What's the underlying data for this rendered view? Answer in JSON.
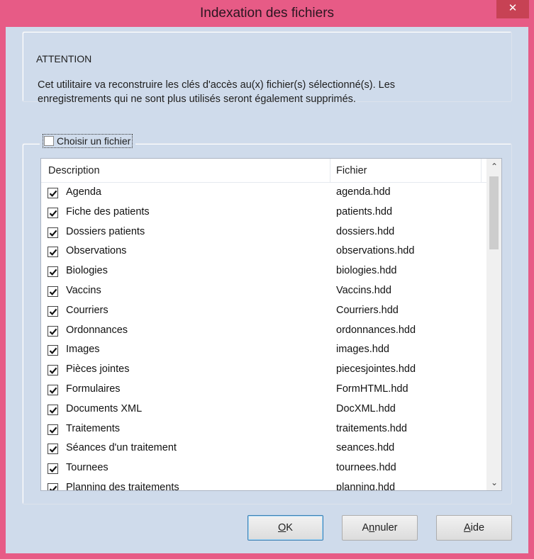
{
  "window": {
    "title": "Indexation des fichiers",
    "close_glyph": "✕"
  },
  "attention": {
    "legend": "ATTENTION",
    "line1": "Cet utilitaire va reconstruire les clés d'accès au(x) fichier(s) sélectionné(s). Les",
    "line2": "enregistrements qui ne sont plus utilisés seront également supprimés."
  },
  "choose_file": {
    "label": "Choisir un fichier",
    "checked": false
  },
  "table": {
    "columns": [
      "Description",
      "Fichier"
    ],
    "rows": [
      {
        "description": "Agenda",
        "file": "agenda.hdd",
        "checked": true
      },
      {
        "description": "Fiche des patients",
        "file": "patients.hdd",
        "checked": true
      },
      {
        "description": "Dossiers patients",
        "file": "dossiers.hdd",
        "checked": true
      },
      {
        "description": "Observations",
        "file": "observations.hdd",
        "checked": true
      },
      {
        "description": "Biologies",
        "file": "biologies.hdd",
        "checked": true
      },
      {
        "description": "Vaccins",
        "file": "Vaccins.hdd",
        "checked": true
      },
      {
        "description": "Courriers",
        "file": "Courriers.hdd",
        "checked": true
      },
      {
        "description": "Ordonnances",
        "file": "ordonnances.hdd",
        "checked": true
      },
      {
        "description": "Images",
        "file": "images.hdd",
        "checked": true
      },
      {
        "description": "Pièces jointes",
        "file": "piecesjointes.hdd",
        "checked": true
      },
      {
        "description": "Formulaires",
        "file": "FormHTML.hdd",
        "checked": true
      },
      {
        "description": "Documents XML",
        "file": "DocXML.hdd",
        "checked": true
      },
      {
        "description": "Traitements",
        "file": "traitements.hdd",
        "checked": true
      },
      {
        "description": "Séances d'un traitement",
        "file": "seances.hdd",
        "checked": true
      },
      {
        "description": "Tournees",
        "file": "tournees.hdd",
        "checked": true
      },
      {
        "description": "Planning des traitements",
        "file": "planning.hdd",
        "checked": true
      }
    ],
    "scroll_up_glyph": "⌃",
    "scroll_down_glyph": "⌄"
  },
  "buttons": {
    "ok": {
      "mnemonic": "O",
      "rest": "K"
    },
    "cancel": {
      "before": "A",
      "mnemonic": "n",
      "rest": "nuler"
    },
    "help": {
      "mnemonic": "A",
      "rest": "ide"
    }
  },
  "colors": {
    "titlebar": "#e75b86",
    "client": "#cfdbeb",
    "close_button": "#c74254"
  }
}
